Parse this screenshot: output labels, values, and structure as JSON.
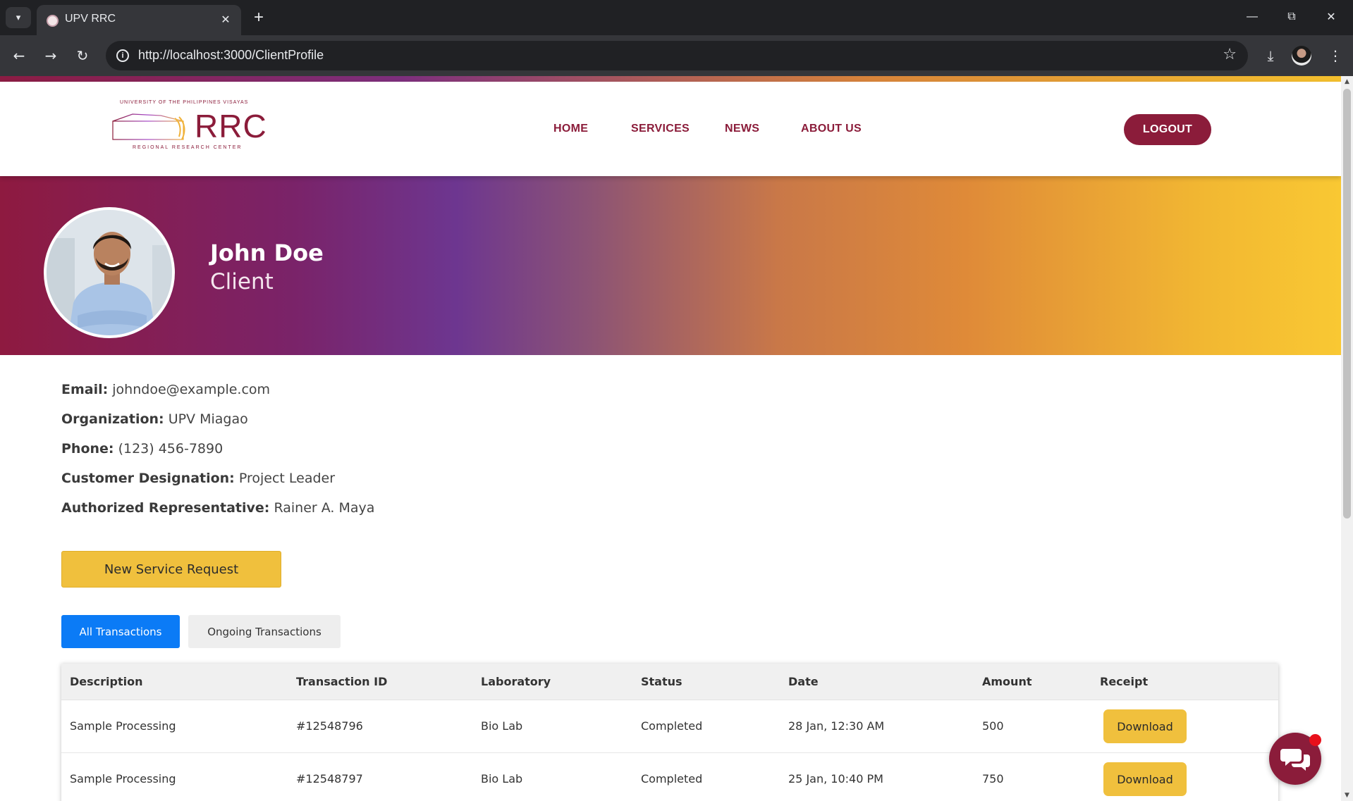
{
  "browser": {
    "tab_title": "UPV RRC",
    "url": "http://localhost:3000/ClientProfile"
  },
  "header": {
    "logo": {
      "top_text": "UNIVERSITY OF THE PHILIPPINES VISAYAS",
      "main_text": "RRC",
      "bottom_text": "REGIONAL RESEARCH CENTER"
    },
    "nav": [
      {
        "label": "HOME"
      },
      {
        "label": "SERVICES"
      },
      {
        "label": "NEWS"
      },
      {
        "label": "ABOUT US"
      }
    ],
    "logout_label": "LOGOUT"
  },
  "profile": {
    "name": "John Doe",
    "role": "Client",
    "fields": [
      {
        "label": "Email:",
        "value": "johndoe@example.com"
      },
      {
        "label": "Organization:",
        "value": "UPV Miagao"
      },
      {
        "label": "Phone:",
        "value": "(123) 456-7890"
      },
      {
        "label": "Customer Designation:",
        "value": "Project Leader"
      },
      {
        "label": "Authorized Representative:",
        "value": "Rainer A. Maya"
      }
    ]
  },
  "actions": {
    "new_request_label": "New Service Request"
  },
  "transaction_tabs": [
    {
      "label": "All Transactions",
      "active": true
    },
    {
      "label": "Ongoing Transactions",
      "active": false
    }
  ],
  "table": {
    "columns": [
      "Description",
      "Transaction ID",
      "Laboratory",
      "Status",
      "Date",
      "Amount",
      "Receipt"
    ],
    "rows": [
      {
        "description": "Sample Processing",
        "transaction_id": "#12548796",
        "laboratory": "Bio Lab",
        "status": "Completed",
        "date": "28 Jan, 12:30 AM",
        "amount": "500",
        "receipt": "Download"
      },
      {
        "description": "Sample Processing",
        "transaction_id": "#12548797",
        "laboratory": "Bio Lab",
        "status": "Completed",
        "date": "25 Jan, 10:40 PM",
        "amount": "750",
        "receipt": "Download"
      }
    ]
  },
  "colors": {
    "brand_maroon": "#8b1c3a",
    "accent_yellow": "#f0c03d",
    "active_tab_blue": "#0b7bf6"
  },
  "icons": {
    "chat": "chat-bubbles-icon",
    "back": "arrow-left-icon",
    "forward": "arrow-right-icon",
    "reload": "reload-icon",
    "bookmark": "star-icon",
    "download": "download-icon",
    "menu": "kebab-menu-icon"
  }
}
